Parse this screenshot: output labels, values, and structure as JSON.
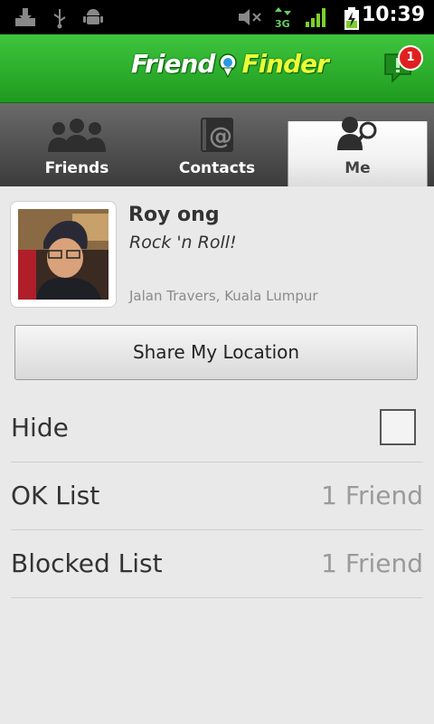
{
  "status_bar": {
    "time": "10:39",
    "network": "3G",
    "icons": [
      "download-icon",
      "usb-icon",
      "android-icon",
      "mute-icon",
      "network-3g-icon",
      "signal-icon",
      "battery-charging-icon"
    ]
  },
  "header": {
    "logo_part1": "Friend",
    "logo_part2": "Finder",
    "notification_count": "1"
  },
  "tabs": [
    {
      "label": "Friends",
      "icon": "friends-icon",
      "active": false
    },
    {
      "label": "Contacts",
      "icon": "contacts-icon",
      "active": false
    },
    {
      "label": "Me",
      "icon": "me-search-icon",
      "active": true
    }
  ],
  "profile": {
    "name": "Roy ong",
    "status": "Rock 'n Roll!",
    "location": "Jalan Travers, Kuala Lumpur"
  },
  "share_button": "Share My Location",
  "settings": [
    {
      "label": "Hide",
      "type": "checkbox",
      "checked": false
    },
    {
      "label": "OK List",
      "value": "1 Friend"
    },
    {
      "label": "Blocked List",
      "value": "1 Friend"
    }
  ],
  "colors": {
    "header_green": "#2fb52f",
    "logo_yellow": "#eaff3a",
    "badge_red": "#e02020"
  }
}
